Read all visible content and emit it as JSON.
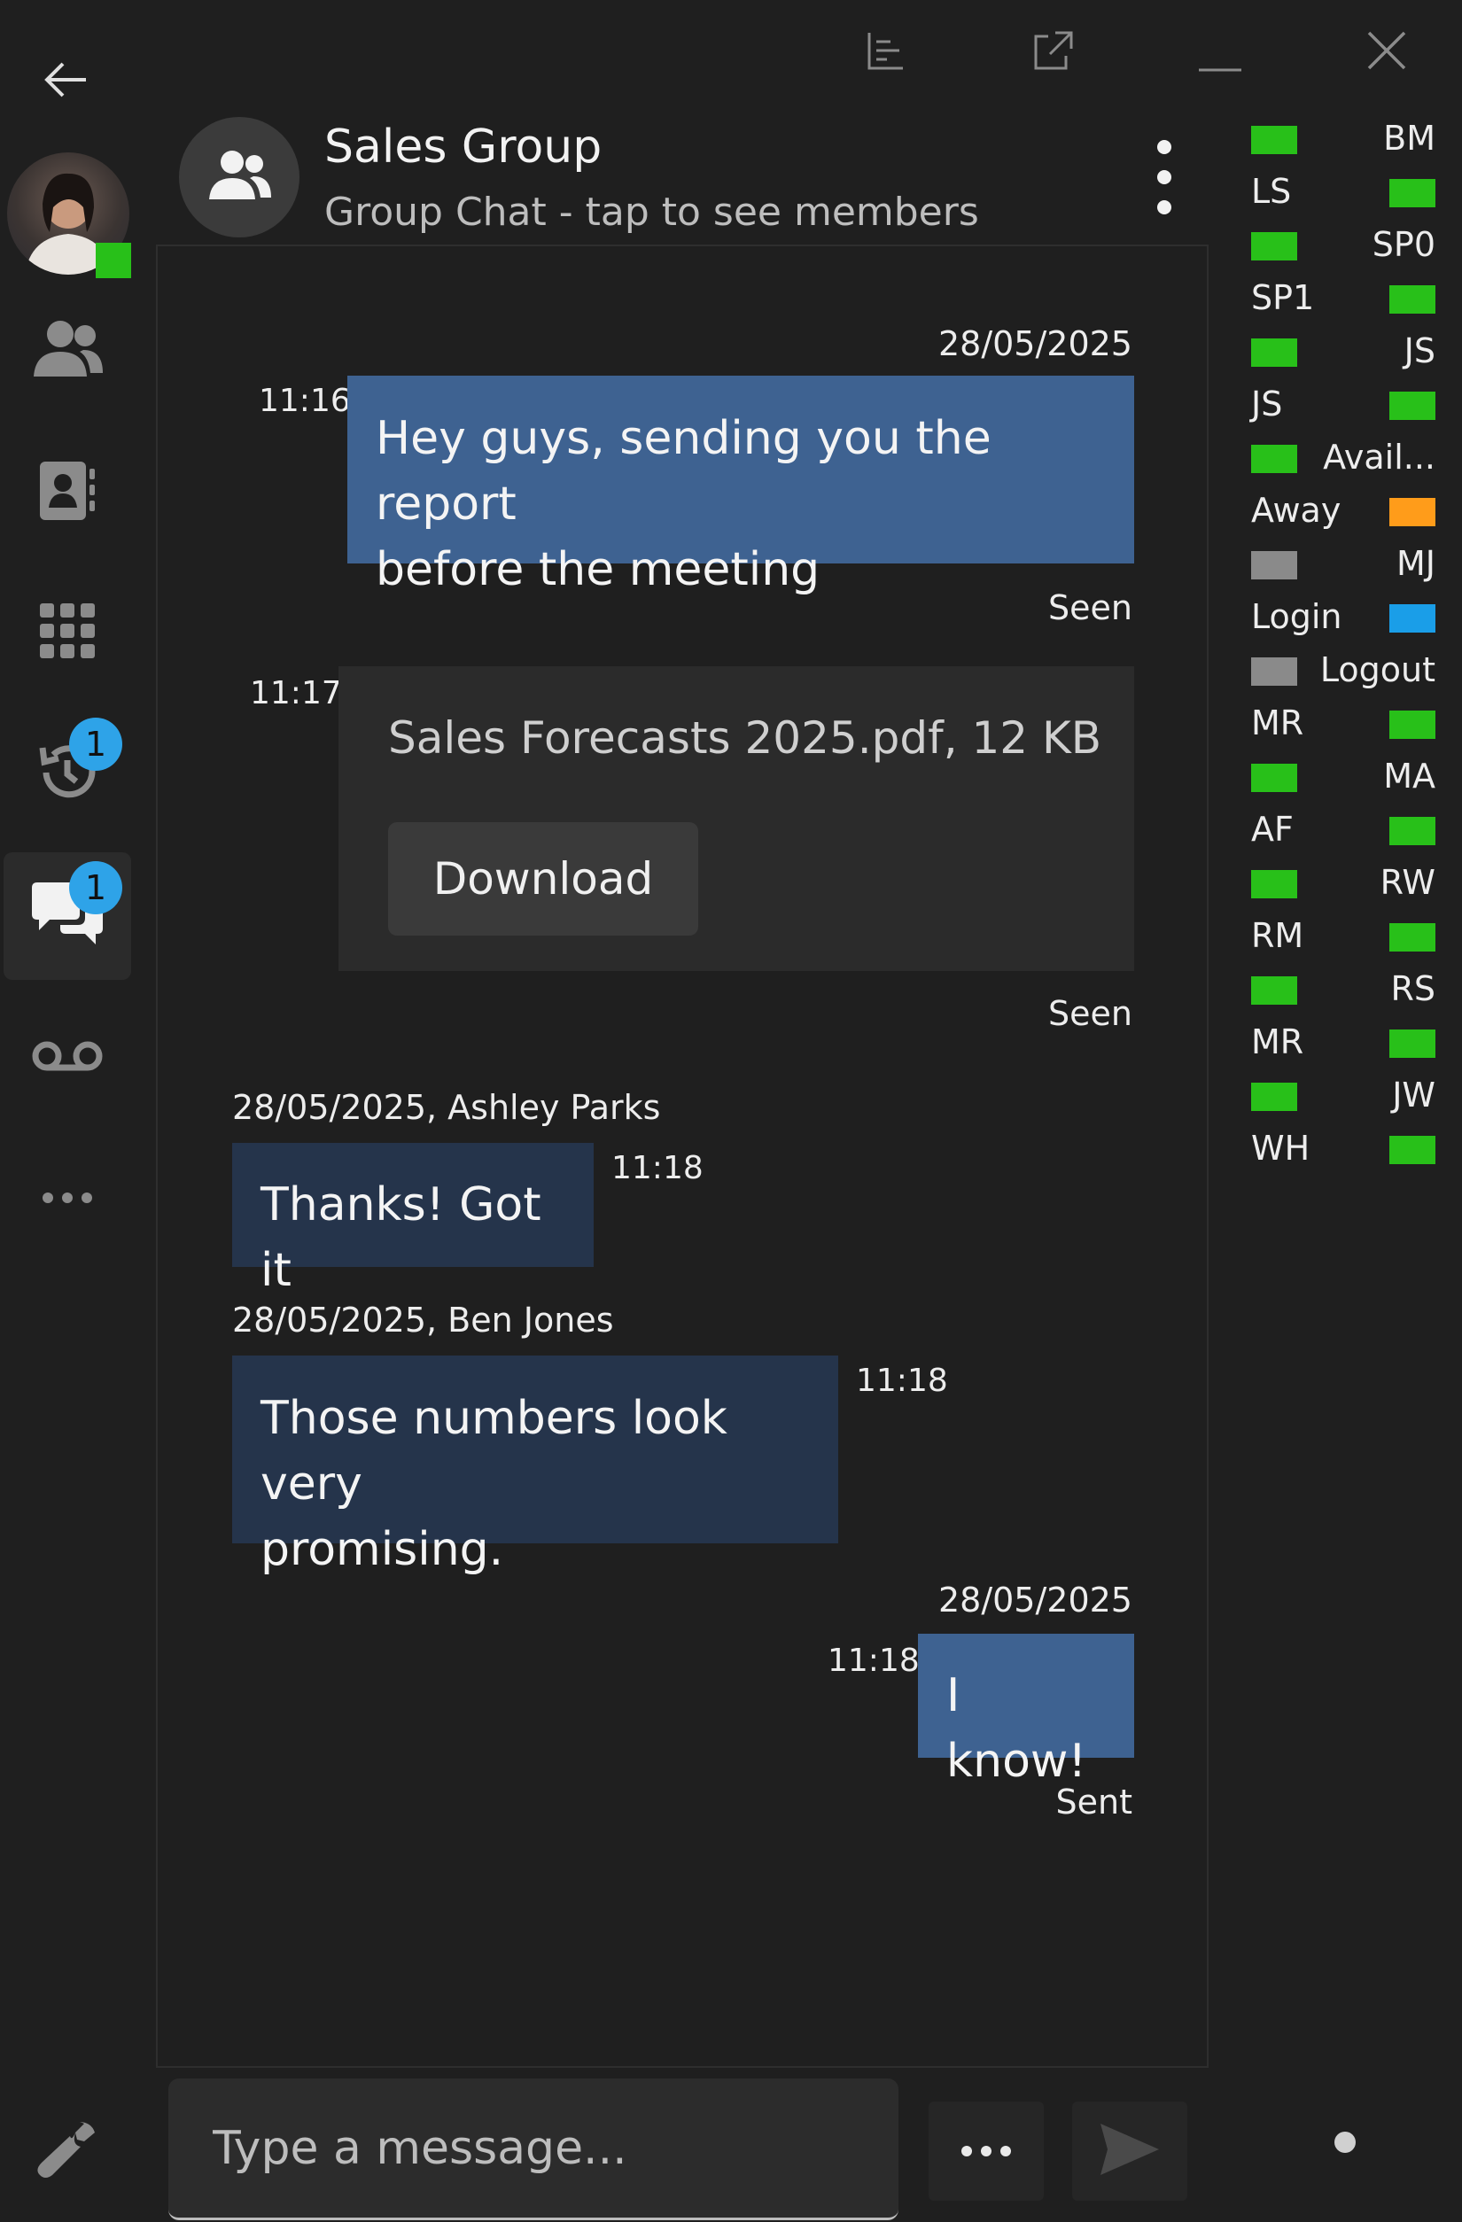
{
  "colors": {
    "available": "#28c019",
    "away": "#ff9c1a",
    "offline": "#8a8a8a",
    "login": "#1a9ee8",
    "accent": "#2ea3e8",
    "outgoing_bubble": "#3e6291",
    "incoming_bubble": "#25344b"
  },
  "nav": {
    "contacts_icon": "people-icon",
    "address_book_icon": "contact-card-icon",
    "dialpad_icon": "dialpad-icon",
    "history_icon": "history-icon",
    "history_badge": "1",
    "chat_icon": "chat-bubbles-icon",
    "chat_badge": "1",
    "voicemail_icon": "voicemail-icon",
    "more_icon": "more-horizontal-icon",
    "settings_icon": "wrench-icon"
  },
  "header": {
    "title": "Sales Group",
    "subtitle": "Group Chat - tap to see members"
  },
  "messages": {
    "m1": {
      "date": "28/05/2025",
      "time": "11:16",
      "text_line1": "Hey guys, sending you the report",
      "text_line2": "before the meeting",
      "status": "Seen"
    },
    "m2": {
      "time": "11:17",
      "file_name": "Sales Forecasts 2025.pdf, 12 KB",
      "download_label": "Download",
      "status": "Seen"
    },
    "m3": {
      "meta": "28/05/2025, Ashley Parks",
      "time": "11:18",
      "text": "Thanks! Got it"
    },
    "m4": {
      "meta": "28/05/2025, Ben Jones",
      "time": "11:18",
      "text_line1": "Those numbers look very",
      "text_line2": "promising."
    },
    "m5": {
      "date": "28/05/2025",
      "time": "11:18",
      "text": "I know!",
      "status": "Sent"
    }
  },
  "composer": {
    "placeholder": "Type a message..."
  },
  "presence": [
    {
      "label": "BM",
      "color": "#28c019"
    },
    {
      "label": "LS",
      "color": "#28c019"
    },
    {
      "label": "SP0",
      "color": "#28c019"
    },
    {
      "label": "SP1",
      "color": "#28c019"
    },
    {
      "label": "JS",
      "color": "#28c019"
    },
    {
      "label": "JS",
      "color": "#28c019"
    },
    {
      "label": "Avail...",
      "color": "#28c019"
    },
    {
      "label": "Away",
      "color": "#ff9c1a"
    },
    {
      "label": "MJ",
      "color": "#8a8a8a"
    },
    {
      "label": "Login",
      "color": "#1a9ee8"
    },
    {
      "label": "Logout",
      "color": "#8a8a8a"
    },
    {
      "label": "MR",
      "color": "#28c019"
    },
    {
      "label": "MA",
      "color": "#28c019"
    },
    {
      "label": "AF",
      "color": "#28c019"
    },
    {
      "label": "RW",
      "color": "#28c019"
    },
    {
      "label": "RM",
      "color": "#28c019"
    },
    {
      "label": "RS",
      "color": "#28c019"
    },
    {
      "label": "MR",
      "color": "#28c019"
    },
    {
      "label": "JW",
      "color": "#28c019"
    },
    {
      "label": "WH",
      "color": "#28c019"
    }
  ]
}
